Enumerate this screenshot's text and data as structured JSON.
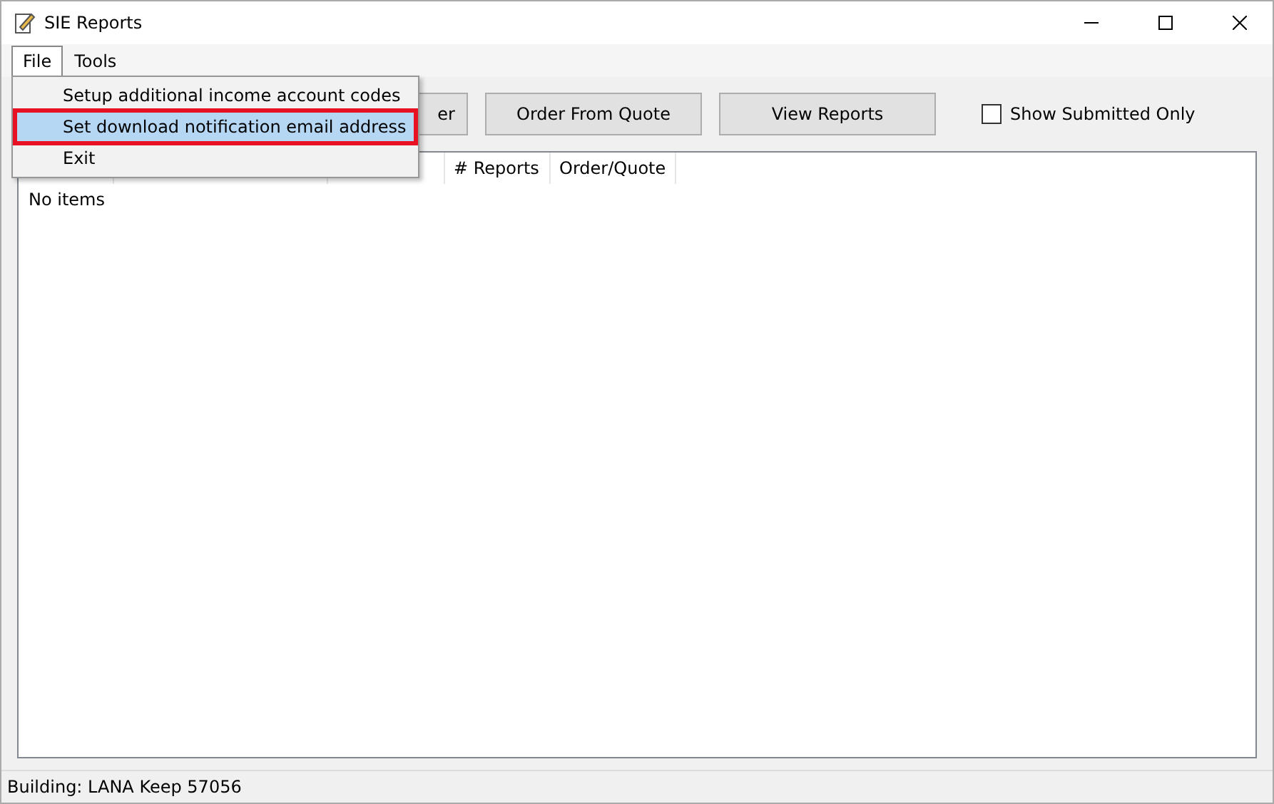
{
  "window": {
    "title": "SIE Reports"
  },
  "menu_bar": [
    {
      "label": "File",
      "selected": true
    },
    {
      "label": "Tools",
      "selected": false
    }
  ],
  "file_menu": [
    {
      "label": "Setup additional income account codes",
      "selected": false,
      "highlighted": false
    },
    {
      "label": "Set download notification email address",
      "selected": true,
      "highlighted": true
    },
    {
      "label": "Exit",
      "selected": false,
      "highlighted": false
    }
  ],
  "toolbar": {
    "buttons": [
      "er",
      "Order From Quote",
      "View Reports"
    ],
    "show_submitted_only": {
      "label": "Show Submitted Only",
      "checked": false
    }
  },
  "list": {
    "columns": [
      "# Reports",
      "Order/Quote"
    ],
    "empty_text": "No items"
  },
  "status_bar": "Building: LANA Keep 57056"
}
